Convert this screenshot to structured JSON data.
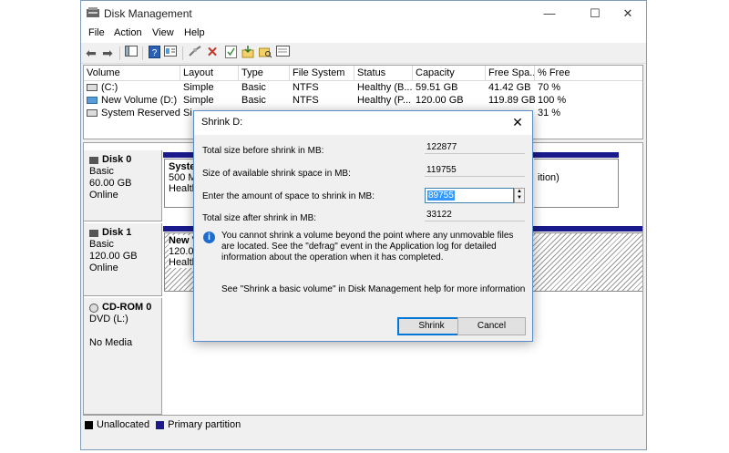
{
  "window": {
    "title": "Disk Management",
    "controls": {
      "minimize": "—",
      "maximize": "☐",
      "close": "✕"
    }
  },
  "menu": [
    "File",
    "Action",
    "View",
    "Help"
  ],
  "toolbar_icons": [
    "back-arrow-icon",
    "forward-arrow-icon",
    "console-tree-icon",
    "help-icon",
    "properties-icon",
    "connect-icon",
    "delete-icon",
    "checkmark-icon",
    "import-icon",
    "search-folder-icon",
    "volume-icon"
  ],
  "volume_list": {
    "columns": [
      "Volume",
      "Layout",
      "Type",
      "File System",
      "Status",
      "Capacity",
      "Free Spa...",
      "% Free"
    ],
    "rows": [
      [
        "(C:)",
        "Simple",
        "Basic",
        "NTFS",
        "Healthy (B...",
        "59.51 GB",
        "41.42 GB",
        "70 %"
      ],
      [
        "New Volume (D:)",
        "Simple",
        "Basic",
        "NTFS",
        "Healthy (P...",
        "120.00 GB",
        "119.89 GB",
        "100 %"
      ],
      [
        "System Reserved",
        "Si",
        "",
        "",
        "",
        "",
        "",
        "31 %"
      ]
    ]
  },
  "disks": [
    {
      "name": "Disk 0",
      "type": "Basic",
      "size": "60.00 GB",
      "status": "Online",
      "partition": {
        "name": "Syster",
        "size": "500 MB",
        "status": "Health"
      },
      "partition_tail": "ition)"
    },
    {
      "name": "Disk 1",
      "type": "Basic",
      "size": "120.00 GB",
      "status": "Online",
      "partition": {
        "name": "New V",
        "size": "120.0",
        "status": "Health"
      }
    },
    {
      "name": "CD-ROM 0",
      "type": "DVD (L:)",
      "status": "No Media"
    }
  ],
  "legend": [
    {
      "label": "Unallocated",
      "color": "#000000"
    },
    {
      "label": "Primary partition",
      "color": "#1a1a8c"
    }
  ],
  "dialog": {
    "title": "Shrink D:",
    "close_glyph": "✕",
    "total_size_label": "Total size before shrink in MB:",
    "total_size_value": "122877",
    "available_label": "Size of available shrink space in MB:",
    "available_value": "119755",
    "amount_label": "Enter the amount of space to shrink in MB:",
    "amount_value": "89755",
    "after_label": "Total size after shrink in MB:",
    "after_value": "33122",
    "info_text": "You cannot shrink a volume beyond the point where any unmovable files are located. See the \"defrag\" event in the Application log for detailed information about the operation when it has completed.",
    "help_text": "See \"Shrink a basic volume\" in Disk Management help for more information",
    "shrink_button": "Shrink",
    "cancel_button": "Cancel"
  }
}
